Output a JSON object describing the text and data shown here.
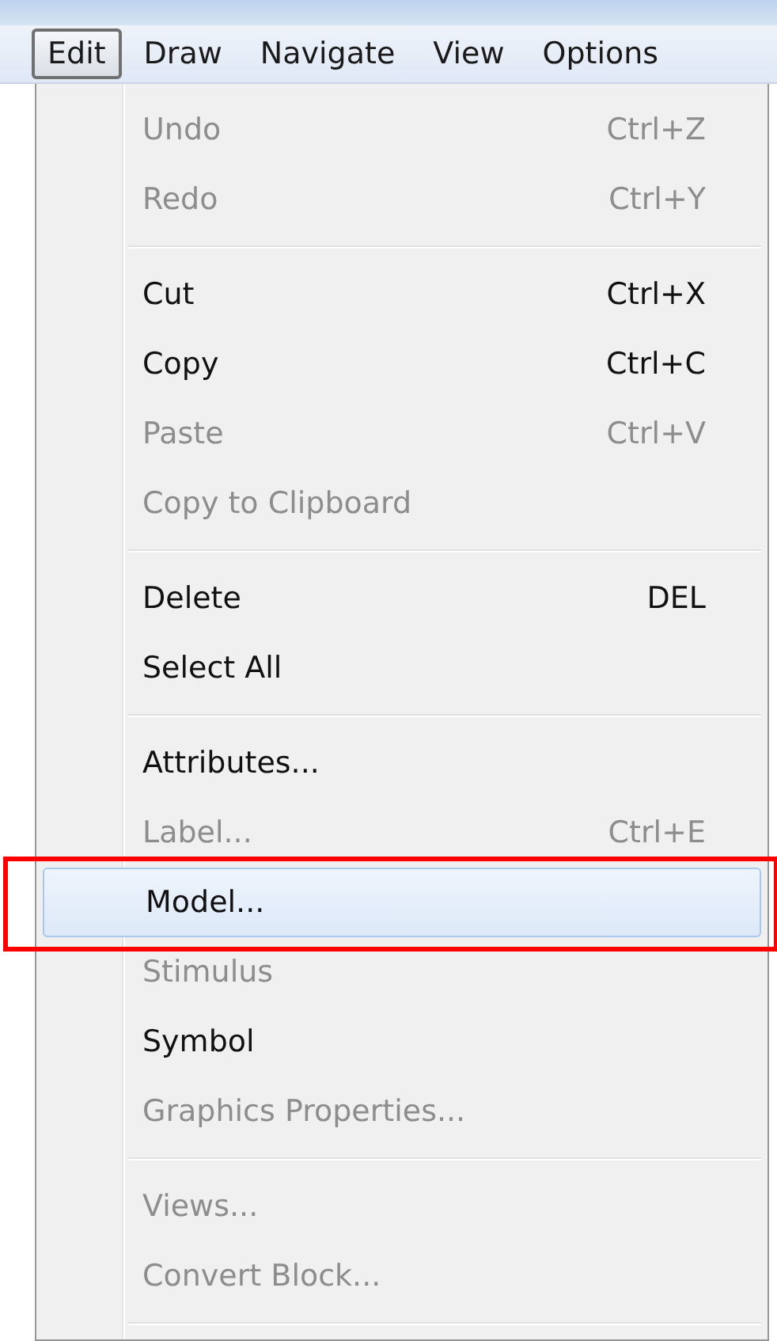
{
  "menu_bar": [
    {
      "label": "Edit",
      "selected": true
    },
    {
      "label": "Draw",
      "selected": false
    },
    {
      "label": "Navigate",
      "selected": false
    },
    {
      "label": "View",
      "selected": false
    },
    {
      "label": "Options",
      "selected": false
    }
  ],
  "menu": [
    {
      "kind": "item",
      "label": "Undo",
      "shortcut": "Ctrl+Z",
      "disabled": true,
      "selected": false
    },
    {
      "kind": "item",
      "label": "Redo",
      "shortcut": "Ctrl+Y",
      "disabled": true,
      "selected": false
    },
    {
      "kind": "separator"
    },
    {
      "kind": "item",
      "label": "Cut",
      "shortcut": "Ctrl+X",
      "disabled": false,
      "selected": false
    },
    {
      "kind": "item",
      "label": "Copy",
      "shortcut": "Ctrl+C",
      "disabled": false,
      "selected": false
    },
    {
      "kind": "item",
      "label": "Paste",
      "shortcut": "Ctrl+V",
      "disabled": true,
      "selected": false
    },
    {
      "kind": "item",
      "label": "Copy to Clipboard",
      "disabled": true,
      "selected": false
    },
    {
      "kind": "separator"
    },
    {
      "kind": "item",
      "label": "Delete",
      "shortcut": "DEL",
      "disabled": false,
      "selected": false
    },
    {
      "kind": "item",
      "label": "Select All",
      "disabled": false,
      "selected": false
    },
    {
      "kind": "separator"
    },
    {
      "kind": "item",
      "label": "Attributes...",
      "disabled": false,
      "selected": false
    },
    {
      "kind": "item",
      "label": "Label...",
      "shortcut": "Ctrl+E",
      "disabled": true,
      "selected": false
    },
    {
      "kind": "item",
      "label": "Model...",
      "disabled": false,
      "selected": true
    },
    {
      "kind": "item",
      "label": "Stimulus",
      "disabled": true,
      "selected": false
    },
    {
      "kind": "item",
      "label": "Symbol",
      "disabled": false,
      "selected": false
    },
    {
      "kind": "item",
      "label": "Graphics Properties...",
      "disabled": true,
      "selected": false
    },
    {
      "kind": "separator"
    },
    {
      "kind": "item",
      "label": "Views...",
      "disabled": true,
      "selected": false
    },
    {
      "kind": "item",
      "label": "Convert Block...",
      "disabled": true,
      "selected": false
    },
    {
      "kind": "separator"
    }
  ]
}
